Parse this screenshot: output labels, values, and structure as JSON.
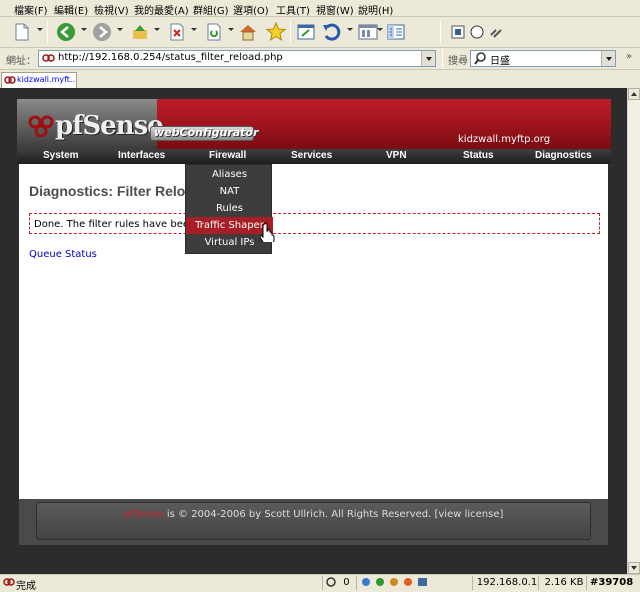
{
  "menubar": {
    "items": [
      "檔案(F)",
      "編輯(E)",
      "檢視(V)",
      "我的最愛(A)",
      "群組(G)",
      "選項(O)",
      "工具(T)",
      "視窗(W)",
      "說明(H)"
    ]
  },
  "address": {
    "label": "網址：",
    "url": "http://192.168.0.254/status_filter_reload.php",
    "search_label": "搜尋",
    "search_value": "日盛"
  },
  "tab": {
    "label": "kidzwall.myft..."
  },
  "site": {
    "logo": "pfSense",
    "subtitle": "webConfigurator",
    "hostname": "kidzwall.myftp.org"
  },
  "nav": {
    "items": [
      "System",
      "Interfaces",
      "Firewall",
      "Services",
      "VPN",
      "Status",
      "Diagnostics"
    ]
  },
  "firewall_menu": {
    "items": [
      "Aliases",
      "NAT",
      "Rules",
      "Traffic Shaper",
      "Virtual IPs"
    ],
    "active": "Traffic Shaper"
  },
  "page": {
    "title": "Diagnostics: Filter Reload",
    "message": "Done. The filter rules have been reloaded.",
    "link": "Queue Status"
  },
  "footer": {
    "brand": "pfSense",
    "text": " is © 2004-2006 by Scott Ullrich. All Rights Reserved. [view license]"
  },
  "status": {
    "left": "完成",
    "count": "0",
    "ip": "192.168.0.1",
    "size": "2.16 KB",
    "watermark": "#39708"
  },
  "colors": {
    "accent_red": "#a71e27",
    "link_blue": "#0000c0",
    "header_gray": "#6a6a6a"
  }
}
